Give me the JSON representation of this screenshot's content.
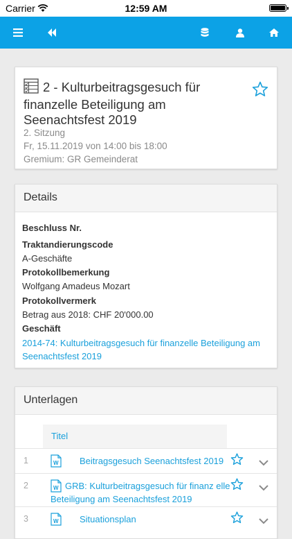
{
  "status_bar": {
    "carrier": "Carrier",
    "time": "12:59 AM"
  },
  "navbar": {
    "icons": [
      "menu-icon",
      "double-chevron-left-icon",
      "database-icon",
      "user-icon",
      "home-icon"
    ],
    "color": "#0ca2e6"
  },
  "item": {
    "title": "2 - Kulturbeitragsgesuch für finanzelle Beteiligung am Seenachtsfest 2019",
    "session": "2. Sitzung",
    "datetime": "Fr, 15.11.2019 von 14:00 bis 18:00",
    "gremium": "Gremium: GR Gemeinderat"
  },
  "details": {
    "header": "Details",
    "beschluss_label": "Beschluss Nr.",
    "trakt_label": "Traktandierungscode",
    "trakt_value": "A-Geschäfte",
    "protokollbemerkung_label": "Protokollbemerkung",
    "protokollbemerkung_value": "Wolfgang Amadeus Mozart",
    "protokollvermerk_label": "Protokollvermerk",
    "protokollvermerk_value": "Betrag aus 2018: CHF 20'000.00",
    "geschaeft_label": "Geschäft",
    "geschaeft_value": "2014-74: Kulturbeitragsgesuch für finanzelle Beteiligung am Seenachtsfest 2019"
  },
  "documents": {
    "header": "Unterlagen",
    "column_title": "Titel",
    "rows": [
      {
        "num": "1",
        "title": "Beitragsgesuch Seenachtsfest 2019"
      },
      {
        "num": "2",
        "title": "GRB: Kulturbeitragsgesuch für finanz elle Beteiligung am Seenachtsfest 2019"
      },
      {
        "num": "3",
        "title": "Situationsplan"
      }
    ]
  },
  "colors": {
    "accent": "#1aa0db",
    "nav": "#0ca2e6"
  }
}
